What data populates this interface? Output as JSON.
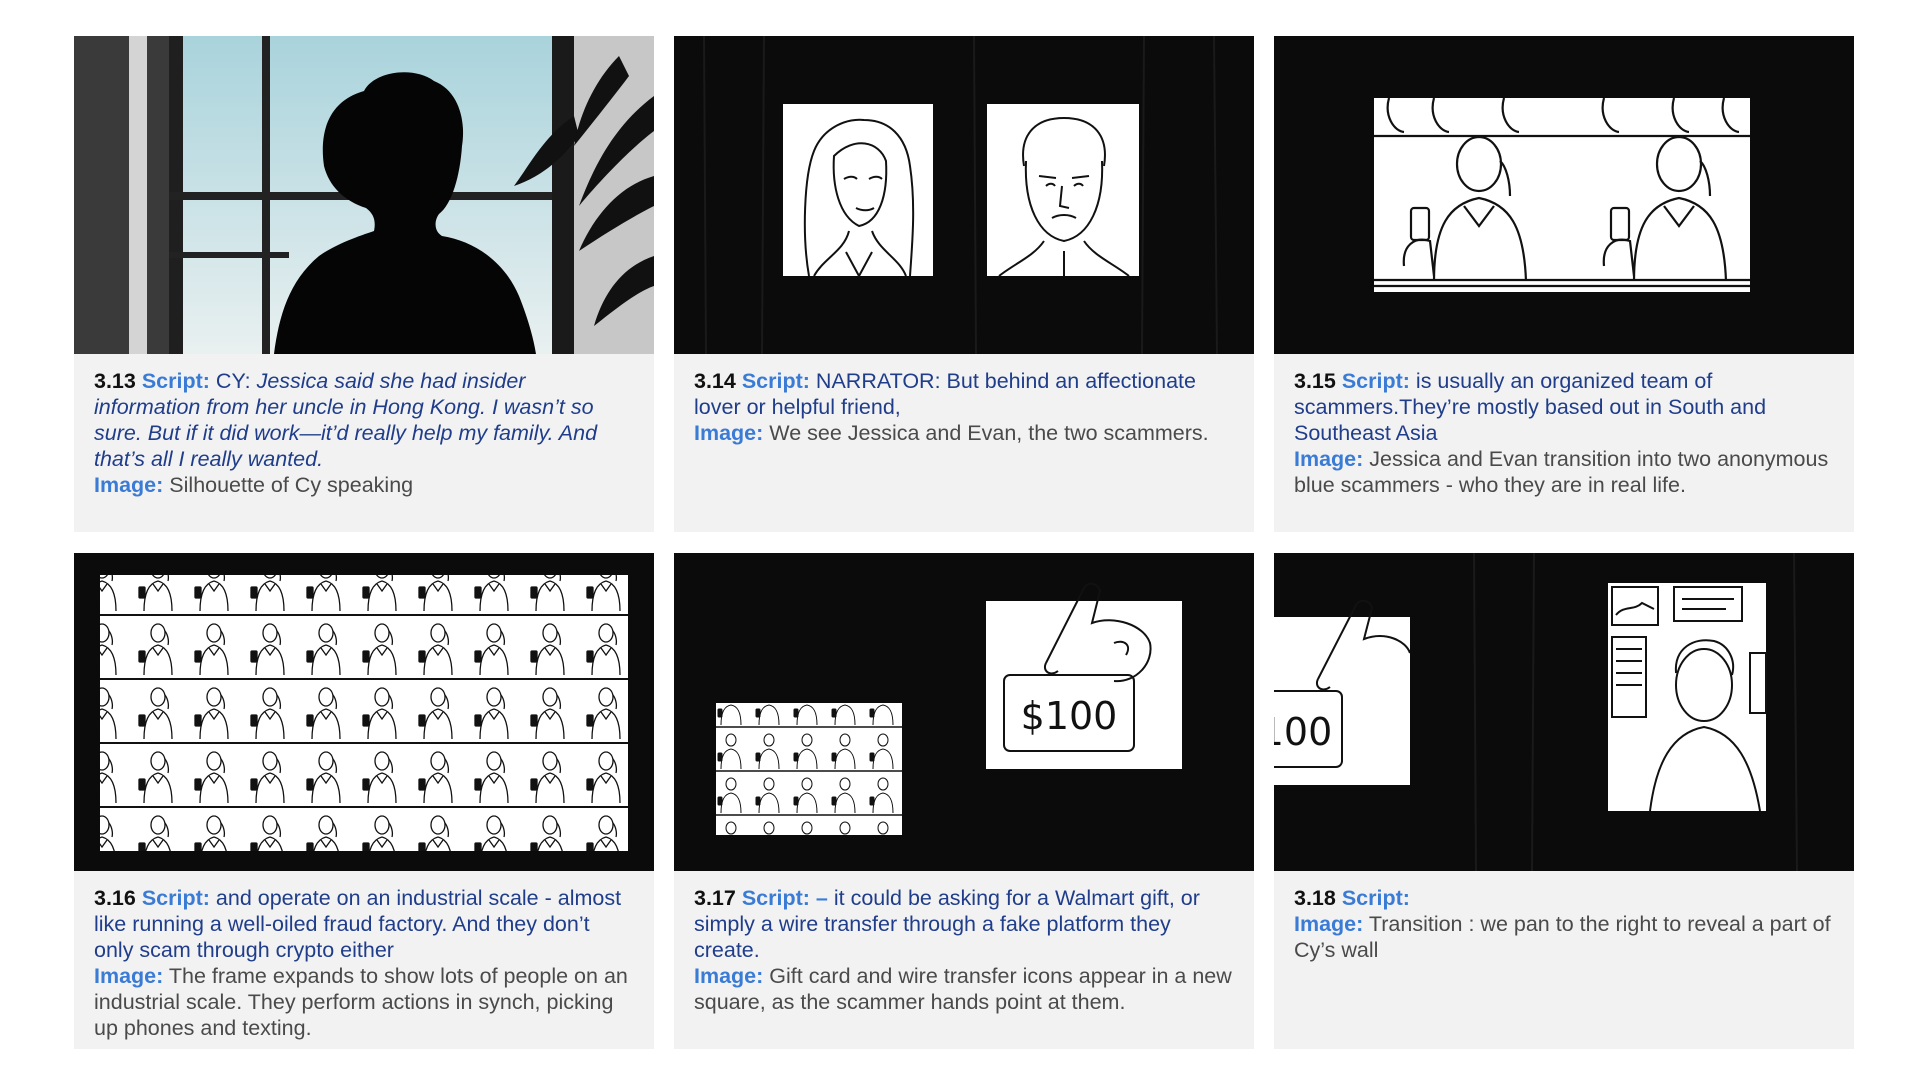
{
  "panels": [
    {
      "number": "3.13",
      "script_label": "Script:",
      "script_prefix": "CY: ",
      "script_text": "Jessica said she had insider information from her uncle in Hong Kong. I wasn’t so sure. But if it did work—it’d really help my family. And that’s all I really wanted.",
      "image_label": "Image:",
      "image_text": "Silhouette of Cy speaking"
    },
    {
      "number": "3.14",
      "script_label": "Script:",
      "script_prefix": "",
      "script_text": "NARRATOR: But behind an affectionate lover or helpful friend,",
      "image_label": "Image:",
      "image_text": "We see Jessica and Evan, the two scammers."
    },
    {
      "number": "3.15",
      "script_label": "Script:",
      "script_prefix": "",
      "script_text": "is usually an organized team of scammers.They’re mostly based out in South and Southeast Asia",
      "image_label": "Image:",
      "image_text": "Jessica and Evan transition into two anonymous blue scammers - who they are in real life."
    },
    {
      "number": "3.16",
      "script_label": "Script:",
      "script_prefix": "",
      "script_text": "and operate on an industrial scale - almost like running a well-oiled fraud factory. And they don’t only scam through crypto either",
      "image_label": "Image:",
      "image_text": "The frame expands to show lots of people on an industrial scale. They perform actions in synch, picking up phones and texting."
    },
    {
      "number": "3.17",
      "script_label": "Script: –",
      "script_prefix": "",
      "script_text": "it could be asking for a Walmart gift, or simply a wire transfer through a fake platform they create.",
      "image_label": "Image:",
      "image_text": "Gift card and wire transfer icons appear in a new square, as the scammer hands point at them."
    },
    {
      "number": "3.18",
      "script_label": "Script:",
      "script_prefix": "",
      "script_text": "",
      "image_label": "Image:",
      "image_text": "Transition : we pan to the right to reveal a part of Cy’s wall"
    }
  ],
  "illustration_text": {
    "gift_amount": "$100",
    "gift_amount_partial": "100"
  },
  "colors": {
    "label_blue": "#3a7bd5",
    "script_navy": "#1f3d8a",
    "caption_bg": "#f2f2f2",
    "frame_black": "#0b0b0b"
  }
}
